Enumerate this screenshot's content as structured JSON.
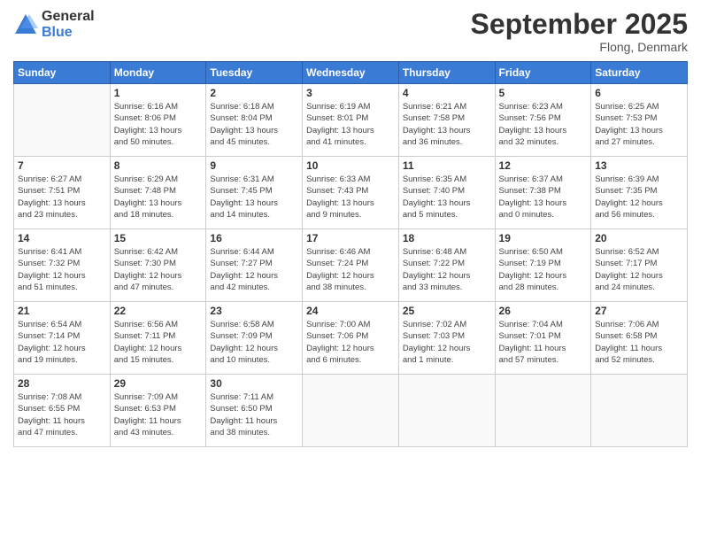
{
  "header": {
    "logo_general": "General",
    "logo_blue": "Blue",
    "month_title": "September 2025",
    "location": "Flong, Denmark"
  },
  "days_of_week": [
    "Sunday",
    "Monday",
    "Tuesday",
    "Wednesday",
    "Thursday",
    "Friday",
    "Saturday"
  ],
  "weeks": [
    [
      {
        "day": "",
        "info": ""
      },
      {
        "day": "1",
        "info": "Sunrise: 6:16 AM\nSunset: 8:06 PM\nDaylight: 13 hours\nand 50 minutes."
      },
      {
        "day": "2",
        "info": "Sunrise: 6:18 AM\nSunset: 8:04 PM\nDaylight: 13 hours\nand 45 minutes."
      },
      {
        "day": "3",
        "info": "Sunrise: 6:19 AM\nSunset: 8:01 PM\nDaylight: 13 hours\nand 41 minutes."
      },
      {
        "day": "4",
        "info": "Sunrise: 6:21 AM\nSunset: 7:58 PM\nDaylight: 13 hours\nand 36 minutes."
      },
      {
        "day": "5",
        "info": "Sunrise: 6:23 AM\nSunset: 7:56 PM\nDaylight: 13 hours\nand 32 minutes."
      },
      {
        "day": "6",
        "info": "Sunrise: 6:25 AM\nSunset: 7:53 PM\nDaylight: 13 hours\nand 27 minutes."
      }
    ],
    [
      {
        "day": "7",
        "info": "Sunrise: 6:27 AM\nSunset: 7:51 PM\nDaylight: 13 hours\nand 23 minutes."
      },
      {
        "day": "8",
        "info": "Sunrise: 6:29 AM\nSunset: 7:48 PM\nDaylight: 13 hours\nand 18 minutes."
      },
      {
        "day": "9",
        "info": "Sunrise: 6:31 AM\nSunset: 7:45 PM\nDaylight: 13 hours\nand 14 minutes."
      },
      {
        "day": "10",
        "info": "Sunrise: 6:33 AM\nSunset: 7:43 PM\nDaylight: 13 hours\nand 9 minutes."
      },
      {
        "day": "11",
        "info": "Sunrise: 6:35 AM\nSunset: 7:40 PM\nDaylight: 13 hours\nand 5 minutes."
      },
      {
        "day": "12",
        "info": "Sunrise: 6:37 AM\nSunset: 7:38 PM\nDaylight: 13 hours\nand 0 minutes."
      },
      {
        "day": "13",
        "info": "Sunrise: 6:39 AM\nSunset: 7:35 PM\nDaylight: 12 hours\nand 56 minutes."
      }
    ],
    [
      {
        "day": "14",
        "info": "Sunrise: 6:41 AM\nSunset: 7:32 PM\nDaylight: 12 hours\nand 51 minutes."
      },
      {
        "day": "15",
        "info": "Sunrise: 6:42 AM\nSunset: 7:30 PM\nDaylight: 12 hours\nand 47 minutes."
      },
      {
        "day": "16",
        "info": "Sunrise: 6:44 AM\nSunset: 7:27 PM\nDaylight: 12 hours\nand 42 minutes."
      },
      {
        "day": "17",
        "info": "Sunrise: 6:46 AM\nSunset: 7:24 PM\nDaylight: 12 hours\nand 38 minutes."
      },
      {
        "day": "18",
        "info": "Sunrise: 6:48 AM\nSunset: 7:22 PM\nDaylight: 12 hours\nand 33 minutes."
      },
      {
        "day": "19",
        "info": "Sunrise: 6:50 AM\nSunset: 7:19 PM\nDaylight: 12 hours\nand 28 minutes."
      },
      {
        "day": "20",
        "info": "Sunrise: 6:52 AM\nSunset: 7:17 PM\nDaylight: 12 hours\nand 24 minutes."
      }
    ],
    [
      {
        "day": "21",
        "info": "Sunrise: 6:54 AM\nSunset: 7:14 PM\nDaylight: 12 hours\nand 19 minutes."
      },
      {
        "day": "22",
        "info": "Sunrise: 6:56 AM\nSunset: 7:11 PM\nDaylight: 12 hours\nand 15 minutes."
      },
      {
        "day": "23",
        "info": "Sunrise: 6:58 AM\nSunset: 7:09 PM\nDaylight: 12 hours\nand 10 minutes."
      },
      {
        "day": "24",
        "info": "Sunrise: 7:00 AM\nSunset: 7:06 PM\nDaylight: 12 hours\nand 6 minutes."
      },
      {
        "day": "25",
        "info": "Sunrise: 7:02 AM\nSunset: 7:03 PM\nDaylight: 12 hours\nand 1 minute."
      },
      {
        "day": "26",
        "info": "Sunrise: 7:04 AM\nSunset: 7:01 PM\nDaylight: 11 hours\nand 57 minutes."
      },
      {
        "day": "27",
        "info": "Sunrise: 7:06 AM\nSunset: 6:58 PM\nDaylight: 11 hours\nand 52 minutes."
      }
    ],
    [
      {
        "day": "28",
        "info": "Sunrise: 7:08 AM\nSunset: 6:55 PM\nDaylight: 11 hours\nand 47 minutes."
      },
      {
        "day": "29",
        "info": "Sunrise: 7:09 AM\nSunset: 6:53 PM\nDaylight: 11 hours\nand 43 minutes."
      },
      {
        "day": "30",
        "info": "Sunrise: 7:11 AM\nSunset: 6:50 PM\nDaylight: 11 hours\nand 38 minutes."
      },
      {
        "day": "",
        "info": ""
      },
      {
        "day": "",
        "info": ""
      },
      {
        "day": "",
        "info": ""
      },
      {
        "day": "",
        "info": ""
      }
    ]
  ]
}
